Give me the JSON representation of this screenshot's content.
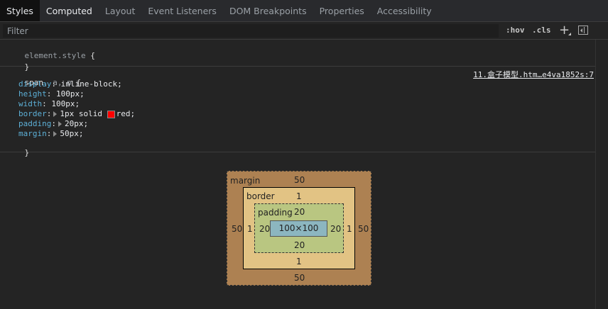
{
  "tabs": [
    {
      "label": "Styles",
      "state": "active"
    },
    {
      "label": "Computed",
      "state": "selected"
    },
    {
      "label": "Layout",
      "state": "normal"
    },
    {
      "label": "Event Listeners",
      "state": "normal"
    },
    {
      "label": "DOM Breakpoints",
      "state": "normal"
    },
    {
      "label": "Properties",
      "state": "normal"
    },
    {
      "label": "Accessibility",
      "state": "normal"
    }
  ],
  "filter": {
    "placeholder": "Filter",
    "hov": ":hov",
    "cls": ".cls",
    "new_rule_icon": "plus-icon",
    "sidebar_icon": "toggle-sidebar-icon"
  },
  "element_style": {
    "selector": "element.style",
    "open": "{",
    "close": "}"
  },
  "rule": {
    "selector_main": "span",
    "selector_rest": ", a, p",
    "open": "{",
    "close": "}",
    "source": "11.盒子模型.htm…e4va1852s:7",
    "declarations": [
      {
        "prop": "display",
        "value": "inline-block;",
        "expandable": false
      },
      {
        "prop": "height",
        "value": "100px;",
        "expandable": false
      },
      {
        "prop": "width",
        "value": "100px;",
        "expandable": false
      },
      {
        "prop": "border",
        "value_pre": "1px solid ",
        "value": "red;",
        "swatch": "#ff0000",
        "expandable": true
      },
      {
        "prop": "padding",
        "value": "20px;",
        "expandable": true
      },
      {
        "prop": "margin",
        "value": "50px;",
        "expandable": true
      }
    ]
  },
  "box_model": {
    "margin": {
      "label": "margin",
      "top": "50",
      "right": "50",
      "bottom": "50",
      "left": "50",
      "color": "#ad8152"
    },
    "border": {
      "label": "border",
      "top": "1",
      "right": "1",
      "bottom": "1",
      "left": "1",
      "color": "#e2c384"
    },
    "padding": {
      "label": "padding",
      "top": "20",
      "right": "20",
      "bottom": "20",
      "left": "20",
      "color": "#b9c681"
    },
    "content": {
      "size": "100×100",
      "color": "#8cb6c0"
    }
  }
}
